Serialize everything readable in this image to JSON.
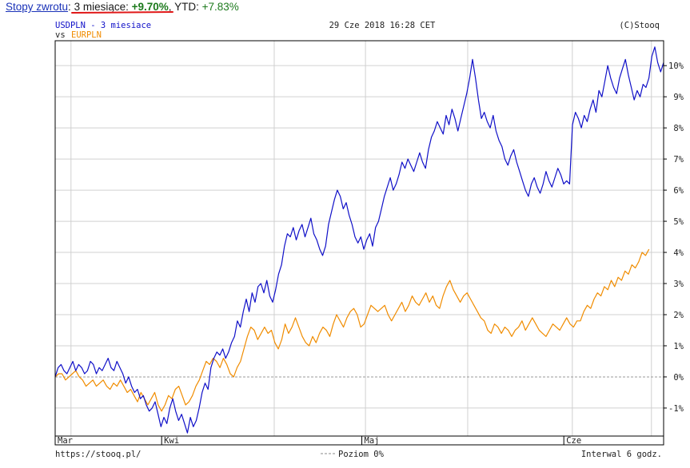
{
  "header": {
    "link_label": "Stopy zwrotu",
    "colon": ":",
    "period_label": "3 miesiące:",
    "period_value": "+9.70%",
    "comma": ",",
    "ytd_label": "YTD:",
    "ytd_value": "+7.83%"
  },
  "chart_info": {
    "line1": "USDPLN - 3 miesiace",
    "vs": "vs",
    "compare": "EURPLN",
    "timestamp": "29 Cze 2018 16:28 CET",
    "copyright": "(C)Stooq",
    "source_url": "https://stooq.pl/",
    "legend_level": "Poziom 0%",
    "interval": "Interwal 6 godz."
  },
  "colors": {
    "usdpln": "#1010c8",
    "eurpln": "#f08c00",
    "grid": "#d0d0d0",
    "frame": "#000000",
    "accent_red": "#e01818",
    "positive": "#1d7a1d"
  },
  "chart_data": {
    "type": "line",
    "title": "USDPLN - 3 miesiace",
    "x_ticks": [
      "Mar",
      "Kwi",
      "Maj",
      "Cze"
    ],
    "y_ticks": [
      "10%",
      "9%",
      "8%",
      "7%",
      "6%",
      "5%",
      "4%",
      "3%",
      "2%",
      "1%",
      "0%",
      "-1%"
    ],
    "ylim": [
      -1.9,
      10.8
    ],
    "grid": true,
    "series": [
      {
        "name": "USDPLN",
        "color": "#1010c8",
        "values": [
          0.0,
          0.3,
          0.4,
          0.2,
          0.1,
          0.3,
          0.5,
          0.2,
          0.4,
          0.3,
          0.1,
          0.2,
          0.5,
          0.4,
          0.1,
          0.3,
          0.2,
          0.4,
          0.6,
          0.3,
          0.2,
          0.5,
          0.3,
          0.1,
          -0.2,
          0.0,
          -0.3,
          -0.5,
          -0.4,
          -0.7,
          -0.6,
          -0.9,
          -1.1,
          -1.0,
          -0.8,
          -1.2,
          -1.6,
          -1.3,
          -1.5,
          -1.0,
          -0.7,
          -1.1,
          -1.4,
          -1.2,
          -1.5,
          -1.8,
          -1.3,
          -1.6,
          -1.4,
          -1.0,
          -0.5,
          -0.2,
          -0.4,
          0.3,
          0.6,
          0.8,
          0.7,
          0.9,
          0.6,
          0.8,
          1.1,
          1.3,
          1.8,
          1.6,
          2.1,
          2.5,
          2.1,
          2.7,
          2.4,
          2.9,
          3.0,
          2.7,
          3.1,
          2.6,
          2.4,
          2.8,
          3.3,
          3.6,
          4.2,
          4.6,
          4.5,
          4.8,
          4.4,
          4.7,
          4.9,
          4.5,
          4.8,
          5.1,
          4.6,
          4.4,
          4.1,
          3.9,
          4.2,
          4.9,
          5.3,
          5.7,
          6.0,
          5.8,
          5.4,
          5.6,
          5.2,
          4.9,
          4.5,
          4.3,
          4.5,
          4.1,
          4.4,
          4.6,
          4.2,
          4.8,
          5.0,
          5.4,
          5.8,
          6.1,
          6.4,
          6.0,
          6.2,
          6.5,
          6.9,
          6.7,
          7.0,
          6.8,
          6.6,
          6.9,
          7.2,
          6.9,
          6.7,
          7.3,
          7.7,
          7.9,
          8.2,
          8.0,
          7.8,
          8.4,
          8.1,
          8.6,
          8.3,
          7.9,
          8.3,
          8.7,
          9.1,
          9.6,
          10.2,
          9.6,
          8.9,
          8.3,
          8.5,
          8.2,
          8.0,
          8.4,
          7.9,
          7.6,
          7.4,
          7.0,
          6.8,
          7.1,
          7.3,
          6.9,
          6.6,
          6.3,
          6.0,
          5.8,
          6.2,
          6.4,
          6.1,
          5.9,
          6.2,
          6.6,
          6.3,
          6.1,
          6.4,
          6.7,
          6.5,
          6.2,
          6.3,
          6.2,
          8.1,
          8.5,
          8.3,
          8.0,
          8.4,
          8.2,
          8.6,
          8.9,
          8.5,
          9.2,
          9.0,
          9.5,
          10.0,
          9.6,
          9.3,
          9.1,
          9.6,
          9.9,
          10.2,
          9.7,
          9.3,
          8.9,
          9.2,
          9.0,
          9.4,
          9.3,
          9.6,
          10.3,
          10.6,
          10.1,
          9.8,
          10.1
        ]
      },
      {
        "name": "EURPLN",
        "color": "#f08c00",
        "values": [
          0.0,
          0.1,
          0.1,
          -0.1,
          0.0,
          0.1,
          0.2,
          0.0,
          -0.1,
          -0.3,
          -0.2,
          -0.1,
          -0.3,
          -0.2,
          -0.1,
          -0.3,
          -0.4,
          -0.2,
          -0.3,
          -0.1,
          -0.3,
          -0.5,
          -0.4,
          -0.6,
          -0.8,
          -0.5,
          -0.7,
          -0.9,
          -0.7,
          -0.5,
          -0.9,
          -1.1,
          -0.9,
          -0.6,
          -0.7,
          -0.4,
          -0.3,
          -0.6,
          -0.9,
          -0.8,
          -0.6,
          -0.3,
          -0.1,
          0.2,
          0.5,
          0.4,
          0.6,
          0.5,
          0.3,
          0.6,
          0.4,
          0.1,
          0.0,
          0.3,
          0.5,
          0.9,
          1.3,
          1.6,
          1.5,
          1.2,
          1.4,
          1.6,
          1.4,
          1.5,
          1.1,
          0.9,
          1.2,
          1.7,
          1.4,
          1.6,
          1.9,
          1.6,
          1.3,
          1.1,
          1.0,
          1.3,
          1.1,
          1.4,
          1.6,
          1.5,
          1.3,
          1.7,
          2.0,
          1.8,
          1.6,
          1.9,
          2.1,
          2.2,
          2.0,
          1.6,
          1.7,
          2.0,
          2.3,
          2.2,
          2.1,
          2.2,
          2.3,
          2.0,
          1.8,
          2.0,
          2.2,
          2.4,
          2.1,
          2.3,
          2.6,
          2.4,
          2.3,
          2.5,
          2.7,
          2.4,
          2.6,
          2.3,
          2.2,
          2.6,
          2.9,
          3.1,
          2.8,
          2.6,
          2.4,
          2.6,
          2.7,
          2.5,
          2.3,
          2.1,
          1.9,
          1.8,
          1.5,
          1.4,
          1.7,
          1.6,
          1.4,
          1.6,
          1.5,
          1.3,
          1.5,
          1.6,
          1.8,
          1.5,
          1.7,
          1.9,
          1.7,
          1.5,
          1.4,
          1.3,
          1.5,
          1.7,
          1.6,
          1.5,
          1.7,
          1.9,
          1.7,
          1.6,
          1.8,
          1.8,
          2.1,
          2.3,
          2.2,
          2.5,
          2.7,
          2.6,
          2.9,
          2.8,
          3.1,
          2.9,
          3.2,
          3.1,
          3.4,
          3.3,
          3.6,
          3.5,
          3.7,
          4.0,
          3.9,
          4.1
        ]
      }
    ]
  }
}
